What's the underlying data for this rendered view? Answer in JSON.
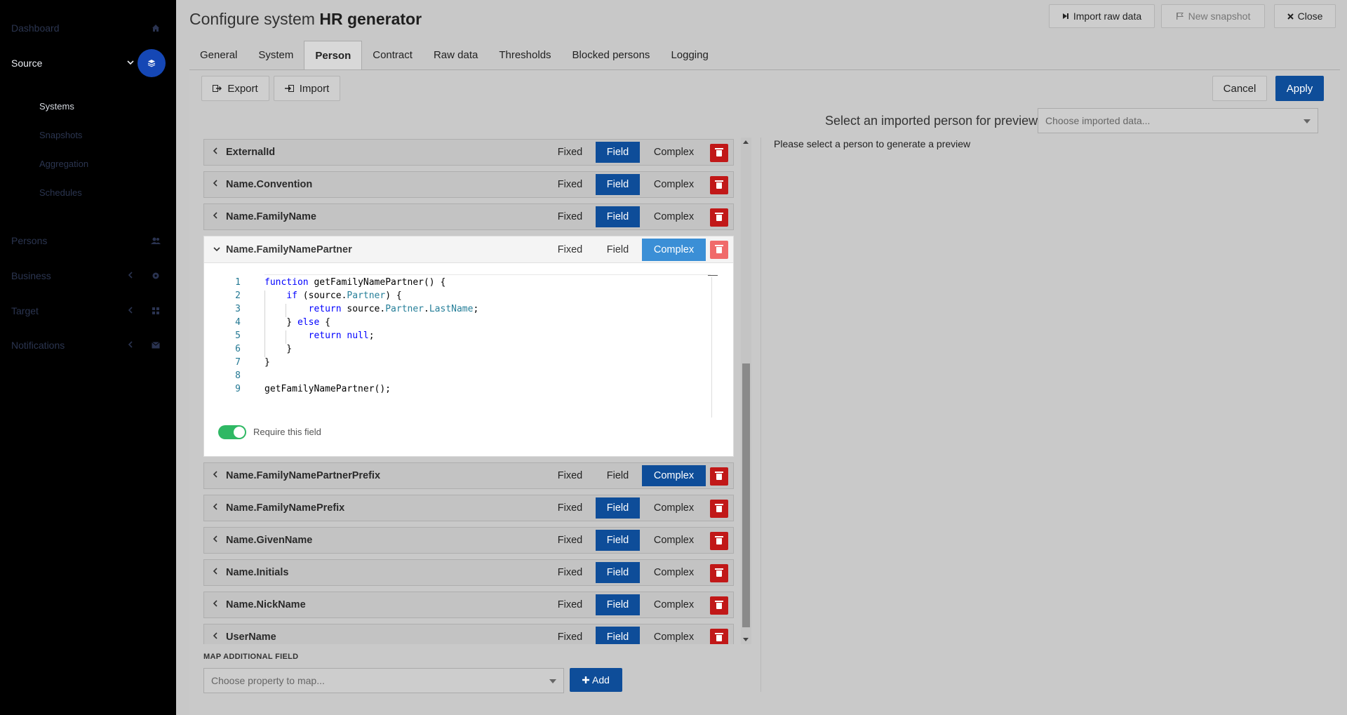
{
  "sidebar": {
    "items": [
      {
        "label": "Dashboard",
        "icon": "home-icon"
      },
      {
        "label": "Source",
        "icon": "layers-icon"
      },
      {
        "label": "Persons",
        "icon": "users-icon"
      },
      {
        "label": "Business",
        "icon": "gear-icon"
      },
      {
        "label": "Target",
        "icon": "grid-icon"
      },
      {
        "label": "Notifications",
        "icon": "envelope-icon"
      }
    ],
    "source_sub": [
      "Systems",
      "Snapshots",
      "Aggregation",
      "Schedules"
    ]
  },
  "header": {
    "title_prefix": "Configure system",
    "title_name": "HR generator",
    "import_raw": "Import raw data",
    "new_snapshot": "New snapshot",
    "close": "Close"
  },
  "tabs": [
    "General",
    "System",
    "Person",
    "Contract",
    "Raw data",
    "Thresholds",
    "Blocked persons",
    "Logging"
  ],
  "active_tab": "Person",
  "toolbar": {
    "export": "Export",
    "import": "Import",
    "cancel": "Cancel",
    "apply": "Apply"
  },
  "preview": {
    "label": "Select an imported person for preview",
    "placeholder": "Choose imported data...",
    "message": "Please select a person to generate a preview"
  },
  "mode_labels": {
    "fixed": "Fixed",
    "field": "Field",
    "complex": "Complex"
  },
  "fields_before": [
    {
      "name": "ExternalId",
      "mode": "field"
    },
    {
      "name": "Name.Convention",
      "mode": "field"
    },
    {
      "name": "Name.FamilyName",
      "mode": "field"
    }
  ],
  "expanded_field": {
    "name": "Name.FamilyNamePartner",
    "mode": "complex",
    "code_lines": [
      "function getFamilyNamePartner() {",
      "    if (source.Partner) {",
      "        return source.Partner.LastName;",
      "    } else {",
      "        return null;",
      "    }",
      "}",
      "",
      "getFamilyNamePartner();"
    ],
    "require_label": "Require this field",
    "require_on": true
  },
  "fields_after": [
    {
      "name": "Name.FamilyNamePartnerPrefix",
      "mode": "complex"
    },
    {
      "name": "Name.FamilyNamePrefix",
      "mode": "field"
    },
    {
      "name": "Name.GivenName",
      "mode": "field"
    },
    {
      "name": "Name.Initials",
      "mode": "field"
    },
    {
      "name": "Name.NickName",
      "mode": "field"
    },
    {
      "name": "UserName",
      "mode": "field"
    }
  ],
  "map_additional": {
    "label": "MAP ADDITIONAL FIELD",
    "placeholder": "Choose property to map...",
    "add": "Add"
  },
  "colors": {
    "primary": "#0e4d99",
    "delete": "#c11818",
    "toggle_on": "#2fb864",
    "complex_active": "#3b8fd6"
  }
}
